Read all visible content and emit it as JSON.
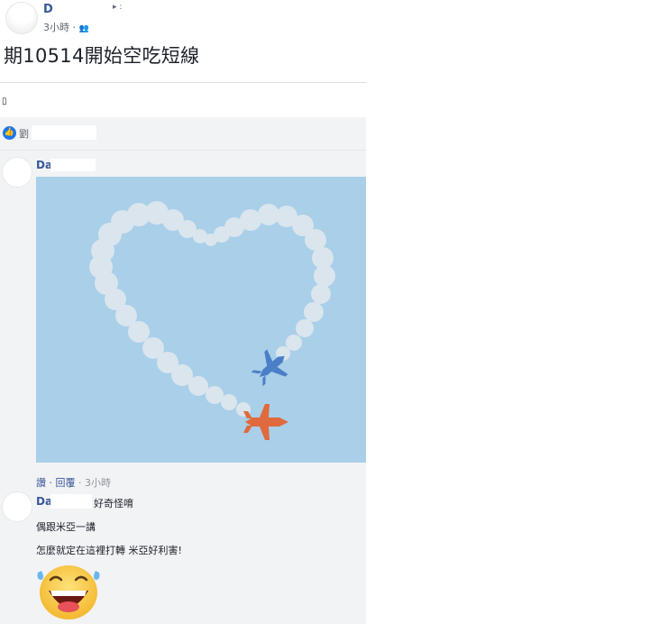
{
  "post": {
    "author": "D",
    "time": "3小時",
    "privacy_sep": "·",
    "privacy_icon": "friends-icon",
    "caret": "▸ :",
    "title": "期10514開始空吃短線",
    "small_text": "▯"
  },
  "reactions": {
    "icon": "like-icon",
    "text": "劉"
  },
  "comment1": {
    "author": "Da",
    "image_alt": "heart drawn by jet smoke trails",
    "like_label": "讚",
    "reply_label": "回覆",
    "time": "3小時",
    "sep": "·"
  },
  "comment2": {
    "author": "Da",
    "line1_suffix": "好奇怪唷",
    "line2": "偶跟米亞一講",
    "line3": "怎麼就定在這裡打轉 米亞好利害!",
    "sticker": "laughing-tears-emoji"
  },
  "colors": {
    "link": "#385898",
    "photo_bg": "#a9cfe9",
    "smoke": "#dfe8ee",
    "jet_blue": "#4a7fc8",
    "jet_orange": "#e06a3e"
  }
}
